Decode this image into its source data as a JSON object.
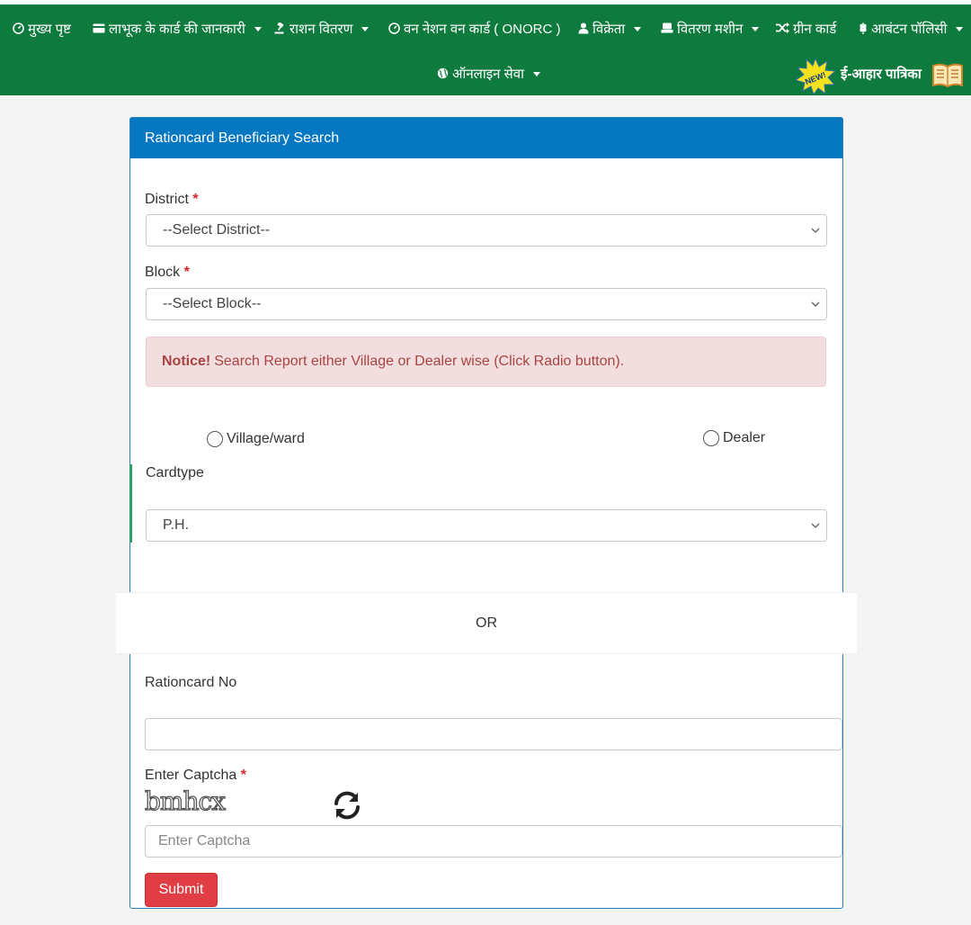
{
  "nav": {
    "items": [
      {
        "label": "मुख्य पृष्ट",
        "icon": "dashboard-icon",
        "dropdown": false
      },
      {
        "label": "लाभूक के कार्ड की जानकारी",
        "icon": "card-icon",
        "dropdown": true
      },
      {
        "label": "राशन वितरण",
        "icon": "gavel-icon",
        "dropdown": true
      },
      {
        "label": "वन नेशन वन कार्ड ( ONORC )",
        "icon": "dashboard-icon",
        "dropdown": false
      },
      {
        "label": "विक्रेता",
        "icon": "user-icon",
        "dropdown": true
      },
      {
        "label": "वितरण मशीन",
        "icon": "machine-icon",
        "dropdown": true
      },
      {
        "label": "ग्रीन कार्ड",
        "icon": "shuffle-icon",
        "dropdown": false
      },
      {
        "label": "आबंटन पॉलिसी",
        "icon": "grain-icon",
        "dropdown": true
      },
      {
        "label": "ऑनलाइन सेवा",
        "icon": "globe-icon",
        "dropdown": true
      }
    ],
    "new_badge": "NEW!",
    "eahar_label": "ई-आहार पात्रिका"
  },
  "panel": {
    "title": "Rationcard Beneficiary Search",
    "district_label": "District",
    "district_value": "--Select District--",
    "block_label": "Block",
    "block_value": "--Select Block--",
    "required_mark": "*",
    "notice_strong": "Notice!",
    "notice_text": "Search Report either Village or Dealer wise (Click Radio button).",
    "radio_village": "Village/ward",
    "radio_dealer": "Dealer",
    "cardtype_label": "Cardtype",
    "cardtype_value": "P.H.",
    "or_text": "OR",
    "rationcard_label": "Rationcard No",
    "rationcard_value": "",
    "captcha_label": "Enter Captcha",
    "captcha_text": "bmhcx",
    "captcha_placeholder": "Enter Captcha",
    "submit_label": "Submit"
  },
  "colors": {
    "nav_bg": "#0f7a3e",
    "panel_header": "#0678c2",
    "notice_bg": "#f2dede",
    "notice_text": "#a94442",
    "submit_bg": "#e03e44"
  }
}
